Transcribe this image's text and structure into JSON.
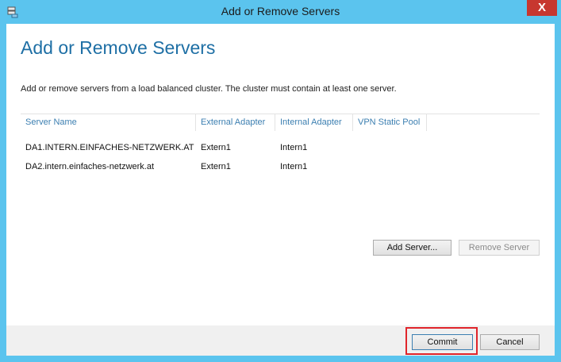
{
  "window": {
    "title": "Add or Remove Servers",
    "close_glyph": "X"
  },
  "main": {
    "heading": "Add or Remove Servers",
    "description": "Add or remove servers from a load balanced cluster. The cluster must contain at least one server."
  },
  "grid": {
    "columns": [
      "Server Name",
      "External Adapter",
      "Internal Adapter",
      "VPN Static Pool"
    ],
    "rows": [
      [
        "DA1.INTERN.EINFACHES-NETZWERK.AT",
        "Extern1",
        "Intern1",
        ""
      ],
      [
        "DA2.intern.einfaches-netzwerk.at",
        "Extern1",
        "Intern1",
        ""
      ]
    ]
  },
  "buttons": {
    "add_server": "Add Server...",
    "remove_server": "Remove Server",
    "commit": "Commit",
    "cancel": "Cancel"
  },
  "colors": {
    "titlebar": "#5bc4ee",
    "heading": "#1e6fa5",
    "highlight": "#e0252b"
  },
  "icons": {
    "app": "server-app-icon",
    "close": "close-icon"
  }
}
